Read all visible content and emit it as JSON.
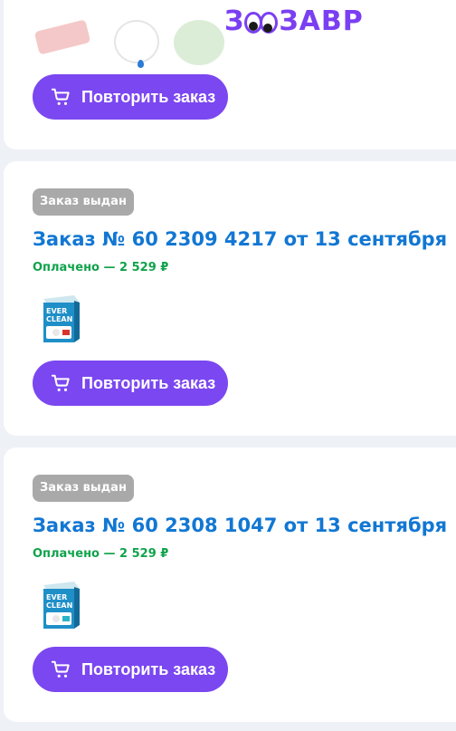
{
  "header": {
    "logo_text": "ЗООЗАВР",
    "logo_left": "З",
    "logo_right": "ЗАВР"
  },
  "orders": [
    {
      "repeat_label": "Повторить заказ"
    },
    {
      "status": "Заказ выдан",
      "title": "Заказ № 60 2309 4217 от 13 сентября",
      "paid": "Оплачено — 2 529 ₽",
      "product_icon": "ever-clean-litter-box-icon",
      "product_accent": "#d9342b",
      "repeat_label": "Повторить заказ"
    },
    {
      "status": "Заказ выдан",
      "title": "Заказ № 60 2308 1047 от 13 сентября",
      "paid": "Оплачено — 2 529 ₽",
      "product_icon": "ever-clean-litter-box-icon",
      "product_accent": "#2bb3c8",
      "repeat_label": "Повторить заказ"
    }
  ],
  "colors": {
    "accent": "#7b47f0",
    "link": "#1277d3",
    "paid": "#10a34b",
    "badge": "#a9a9a9",
    "background": "#eef1f6"
  }
}
